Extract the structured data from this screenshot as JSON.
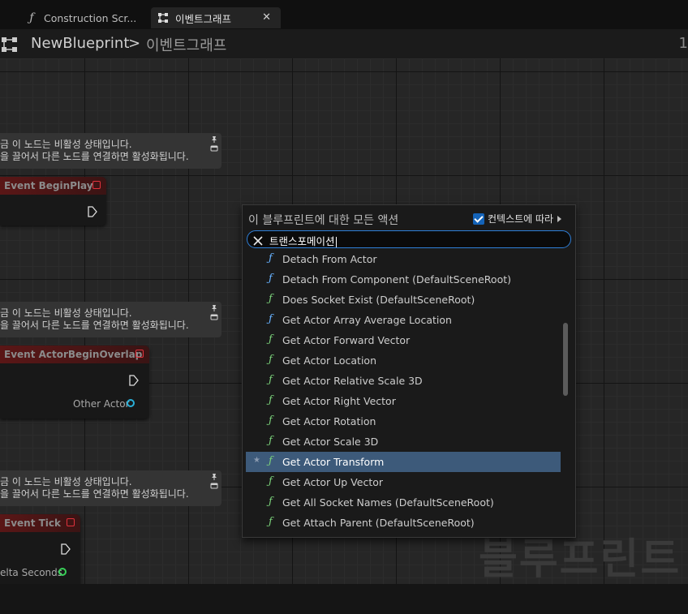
{
  "tabs": [
    {
      "label": "Construction Scr...",
      "icon": "function-icon"
    },
    {
      "label": "이벤트그래프",
      "icon": "event-graph-icon",
      "close": "✕"
    }
  ],
  "breadcrumb": {
    "root": "NewBlueprint",
    "separator": ">",
    "current": "이벤트그래프",
    "right_fragment": "1"
  },
  "comments": [
    {
      "line1": "금 이 노드는 비활성 상태입니다.",
      "line2": "을 끌어서 다른 노드를 연결하면 활성화됩니다."
    },
    {
      "line1": "금 이 노드는 비활성 상태입니다.",
      "line2": "을 끌어서 다른 노드를 연결하면 활성화됩니다."
    },
    {
      "line1": "금 이 노드는 비활성 상태입니다.",
      "line2": "을 끌어서 다른 노드를 연결하면 활성화됩니다."
    }
  ],
  "nodes": {
    "begin_play": {
      "title": "Event BeginPlay"
    },
    "actor_begin_overlap": {
      "title": "Event ActorBeginOverlap",
      "output_label": "Other Actor"
    },
    "tick": {
      "title": "Event Tick",
      "output_label": "elta Seconds"
    }
  },
  "watermark": "블루프린트",
  "action_menu": {
    "title": "이 블루프린트에 대한 모든 액션",
    "context_label": "컨텍스트에 따라",
    "context_checked": true,
    "search_value": "트랜스포메이션",
    "items": [
      {
        "label": "Detach From Actor",
        "color": "blue",
        "selected": false
      },
      {
        "label": "Detach From Component (DefaultSceneRoot)",
        "color": "blue",
        "selected": false
      },
      {
        "label": "Does Socket Exist (DefaultSceneRoot)",
        "color": "green",
        "selected": false
      },
      {
        "label": "Get Actor Array Average Location",
        "color": "blue",
        "selected": false
      },
      {
        "label": "Get Actor Forward Vector",
        "color": "green",
        "selected": false
      },
      {
        "label": "Get Actor Location",
        "color": "green",
        "selected": false
      },
      {
        "label": "Get Actor Relative Scale 3D",
        "color": "green",
        "selected": false
      },
      {
        "label": "Get Actor Right Vector",
        "color": "green",
        "selected": false
      },
      {
        "label": "Get Actor Rotation",
        "color": "green",
        "selected": false
      },
      {
        "label": "Get Actor Scale 3D",
        "color": "green",
        "selected": false
      },
      {
        "label": "Get Actor Transform",
        "color": "green",
        "selected": true
      },
      {
        "label": "Get Actor Up Vector",
        "color": "green",
        "selected": false
      },
      {
        "label": "Get All Socket Names (DefaultSceneRoot)",
        "color": "green",
        "selected": false
      },
      {
        "label": "Get Attach Parent (DefaultSceneRoot)",
        "color": "green",
        "selected": false
      }
    ]
  },
  "colors": {
    "accent": "#2f7fd8",
    "selection": "#3d5a7a",
    "event_node": "#5a1616",
    "pure_function": "#7ad17a",
    "impure_function": "#67b2ff",
    "object_pin": "#2ab0d8",
    "float_pin": "#38d058"
  }
}
